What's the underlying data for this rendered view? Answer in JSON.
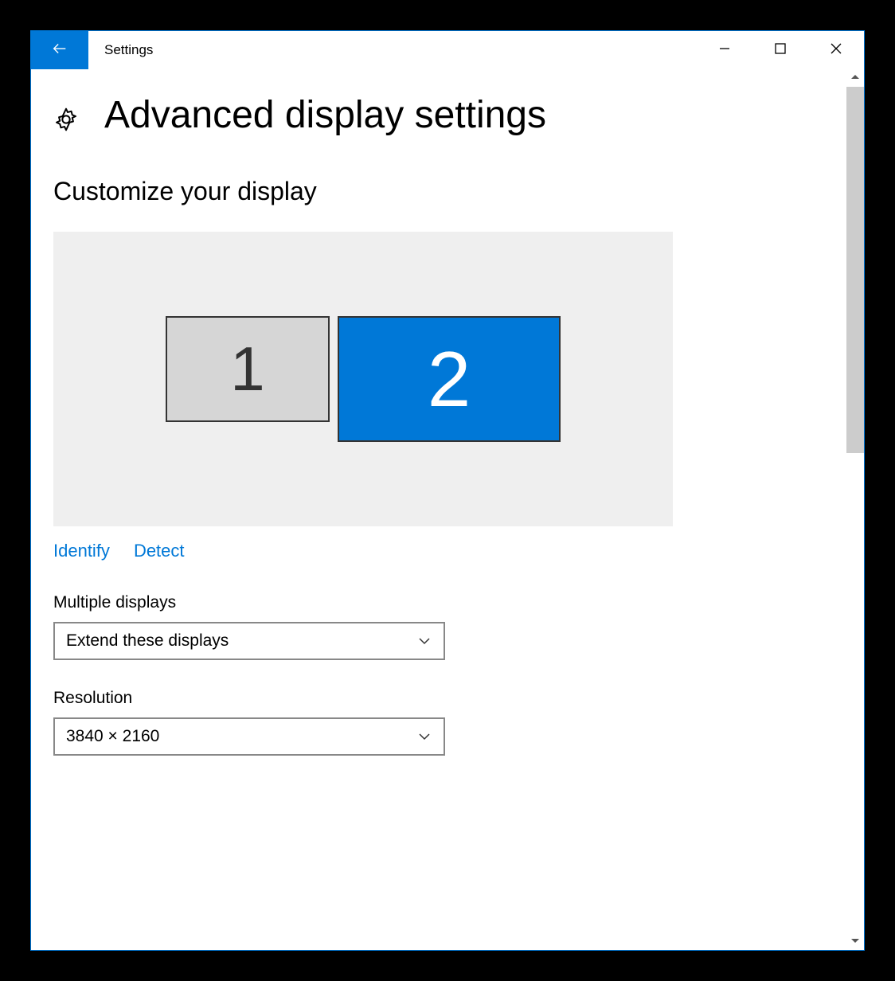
{
  "window": {
    "title": "Settings"
  },
  "page": {
    "title": "Advanced display settings"
  },
  "customize": {
    "section_title": "Customize your display",
    "monitors": [
      {
        "label": "1",
        "selected": false
      },
      {
        "label": "2",
        "selected": true
      }
    ],
    "identify_label": "Identify",
    "detect_label": "Detect"
  },
  "multiple_displays": {
    "label": "Multiple displays",
    "value": "Extend these displays"
  },
  "resolution": {
    "label": "Resolution",
    "value": "3840 × 2160"
  },
  "colors": {
    "accent": "#0078d7"
  }
}
